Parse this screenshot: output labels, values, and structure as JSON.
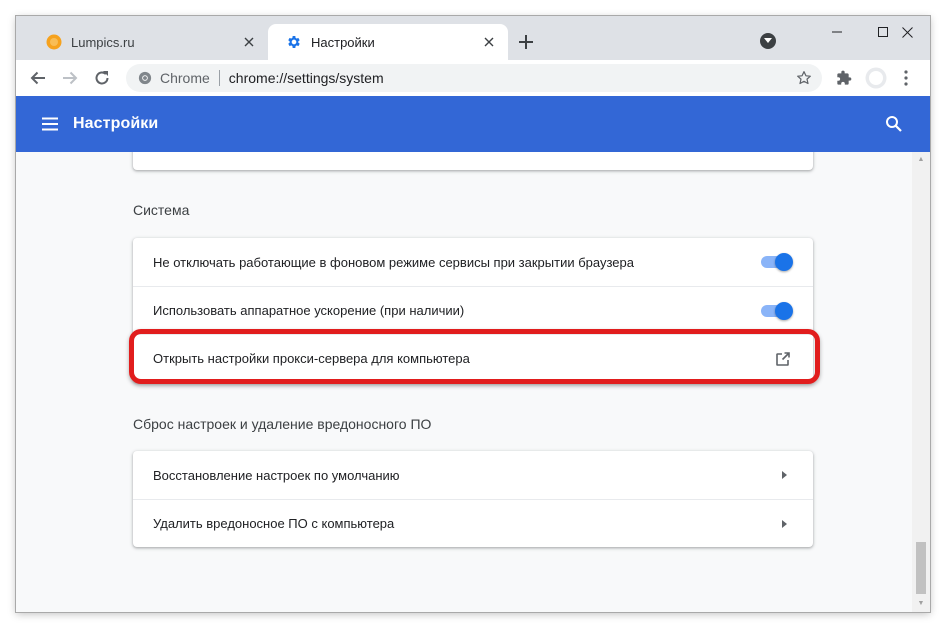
{
  "tabs": [
    {
      "label": "Lumpics.ru",
      "favicon": "orange-circle-icon",
      "active": false
    },
    {
      "label": "Настройки",
      "favicon": "gear-icon",
      "active": true
    }
  ],
  "omnibox": {
    "site_label": "Chrome",
    "url": "chrome://settings/system"
  },
  "header": {
    "title": "Настройки"
  },
  "sections": {
    "system": {
      "title": "Система",
      "rows": [
        {
          "label": "Не отключать работающие в фоновом режиме сервисы при закрытии браузера",
          "toggle": true
        },
        {
          "label": "Использовать аппаратное ускорение (при наличии)",
          "toggle": true
        },
        {
          "label": "Открыть настройки прокси-сервера для компьютера",
          "action": "external-link-icon"
        }
      ]
    },
    "reset": {
      "title": "Сброс настроек и удаление вредоносного ПО",
      "rows": [
        {
          "label": "Восстановление настроек по умолчанию",
          "action": "arrow-right-icon"
        },
        {
          "label": "Удалить вредоносное ПО с компьютера",
          "action": "arrow-right-icon"
        }
      ]
    }
  },
  "colors": {
    "header": "#3367d6",
    "toggle_on": "#1a73e8",
    "highlight": "#e11d1d"
  }
}
